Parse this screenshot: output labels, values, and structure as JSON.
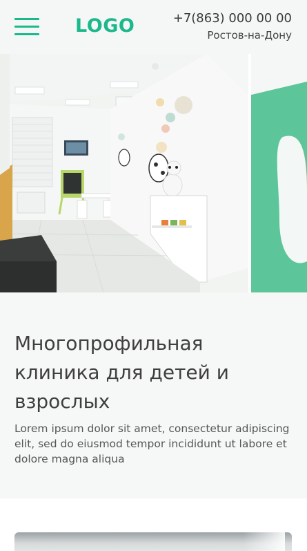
{
  "header": {
    "logo": "LOGO",
    "phone": "+7(863) 000 00 00",
    "city": "Ростов-на-Дону",
    "menu_icon": "hamburger-menu-icon"
  },
  "hero": {
    "image": "clinic-waiting-room-photo"
  },
  "intro": {
    "title": "Многопрофильная клиника для детей и взрослых",
    "text": "Lorem ipsum dolor sit amet, consectetur adipiscing elit, sed do eiusmod tempor incididunt ut labore et dolore magna aliqua"
  },
  "colors": {
    "accent": "#1bb88b",
    "header_bg": "#f5f6f6",
    "section_bg": "#f6f7f7",
    "text": "#3f3f3f"
  }
}
